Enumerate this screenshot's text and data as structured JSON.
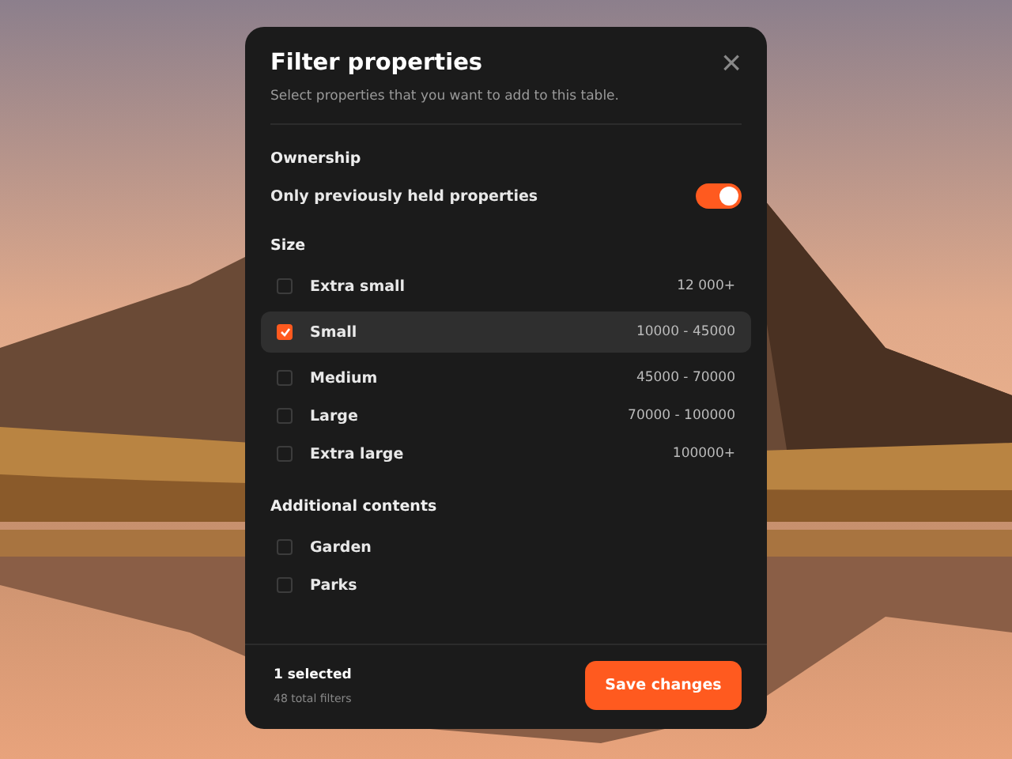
{
  "dialog": {
    "title": "Filter properties",
    "subtitle": "Select properties that you want to add to this table.",
    "close": "×"
  },
  "sections": [
    {
      "heading": "Ownership",
      "items": [
        {
          "kind": "toggle",
          "label": "Only previously held properties",
          "on": true
        }
      ]
    },
    {
      "heading": "Size",
      "items": [
        {
          "kind": "checkbox",
          "label": "Extra small",
          "range": "12 000+",
          "checked": false,
          "selected": false
        },
        {
          "kind": "checkbox",
          "label": "Small",
          "range": "10000 - 45000",
          "checked": true,
          "selected": true
        },
        {
          "kind": "checkbox",
          "label": "Medium",
          "range": "45000 - 70000",
          "checked": false,
          "selected": false
        },
        {
          "kind": "checkbox",
          "label": "Large",
          "range": "70000 - 100000",
          "checked": false,
          "selected": false
        },
        {
          "kind": "checkbox",
          "label": "Extra large",
          "range": "100000+",
          "checked": false,
          "selected": false
        }
      ]
    },
    {
      "heading": "Additional contents",
      "items": [
        {
          "kind": "checkbox",
          "label": "Garden",
          "checked": false,
          "selected": false
        },
        {
          "kind": "checkbox",
          "label": "Parks",
          "checked": false,
          "selected": false
        }
      ]
    }
  ],
  "footer": {
    "selected_count": "1 selected",
    "total": "48 total filters",
    "save": "Save changes"
  }
}
